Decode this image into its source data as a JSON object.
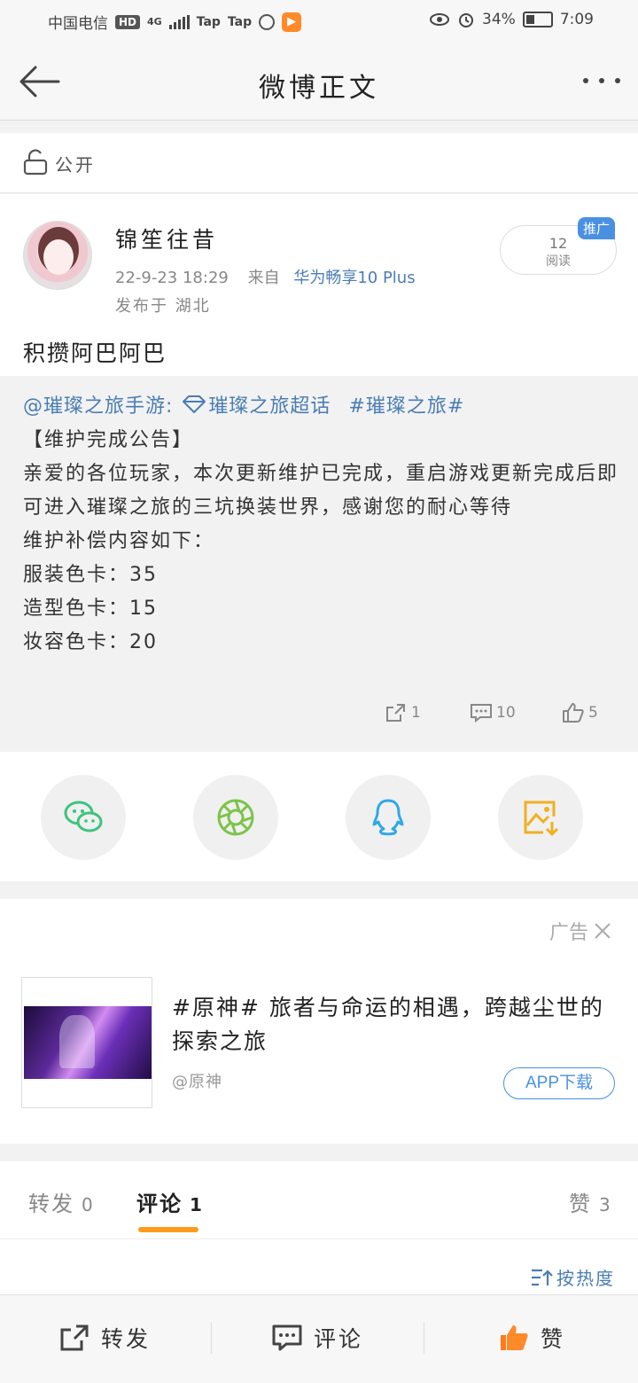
{
  "status_bar": {
    "carrier": "中国电信",
    "hd": "HD",
    "network": "4G",
    "app1": "Tap",
    "app2": "Tap",
    "battery": "34%",
    "battery_level": 0.34,
    "time": "7:09"
  },
  "nav": {
    "title": "微博正文"
  },
  "visibility": {
    "label": "公开"
  },
  "post": {
    "author": "锦笙往昔",
    "date": "22-9-23 18:29",
    "from_label": "来自",
    "device": "华为畅享10 Plus",
    "location": "发布于 湖北",
    "reads_count": "12",
    "reads_label": "阅读",
    "promo_badge": "推广",
    "text": "积攒阿巴阿巴"
  },
  "repost": {
    "mention": "@璀璨之旅手游:",
    "supertopic": "璀璨之旅超话",
    "hashtag": "#璀璨之旅#",
    "lines": [
      "【维护完成公告】",
      "亲爱的各位玩家，本次更新维护已完成，重启游戏更新完成后即可进入璀璨之旅的三坑换装世界，感谢您的耐心等待",
      "维护补偿内容如下：",
      "服装色卡：35",
      "造型色卡：15",
      "妆容色卡：20"
    ],
    "stats": {
      "reposts": "1",
      "comments": "10",
      "likes": "5"
    }
  },
  "share": {
    "icons": [
      "wechat-icon",
      "moments-icon",
      "qq-icon",
      "save-image-icon"
    ],
    "colors": {
      "wechat": "#3cc47c",
      "moments": "#7cc34a",
      "qq": "#2fa8e6",
      "save": "#f0b020"
    }
  },
  "ad": {
    "label": "广告",
    "title": "#原神# 旅者与命运的相遇，跨越尘世的探索之旅",
    "source": "@原神",
    "download": "APP下载"
  },
  "tabs": {
    "repost_label": "转发",
    "repost_count": "0",
    "comment_label": "评论",
    "comment_count": "1",
    "like_label": "赞",
    "like_count": "3"
  },
  "sort": {
    "label": "按热度"
  },
  "bottom_bar": {
    "repost": "转发",
    "comment": "评论",
    "like": "赞"
  },
  "colors": {
    "link_blue": "#4a7db5",
    "accent_orange": "#ff9b1a",
    "promo_blue": "#4a90e2"
  }
}
